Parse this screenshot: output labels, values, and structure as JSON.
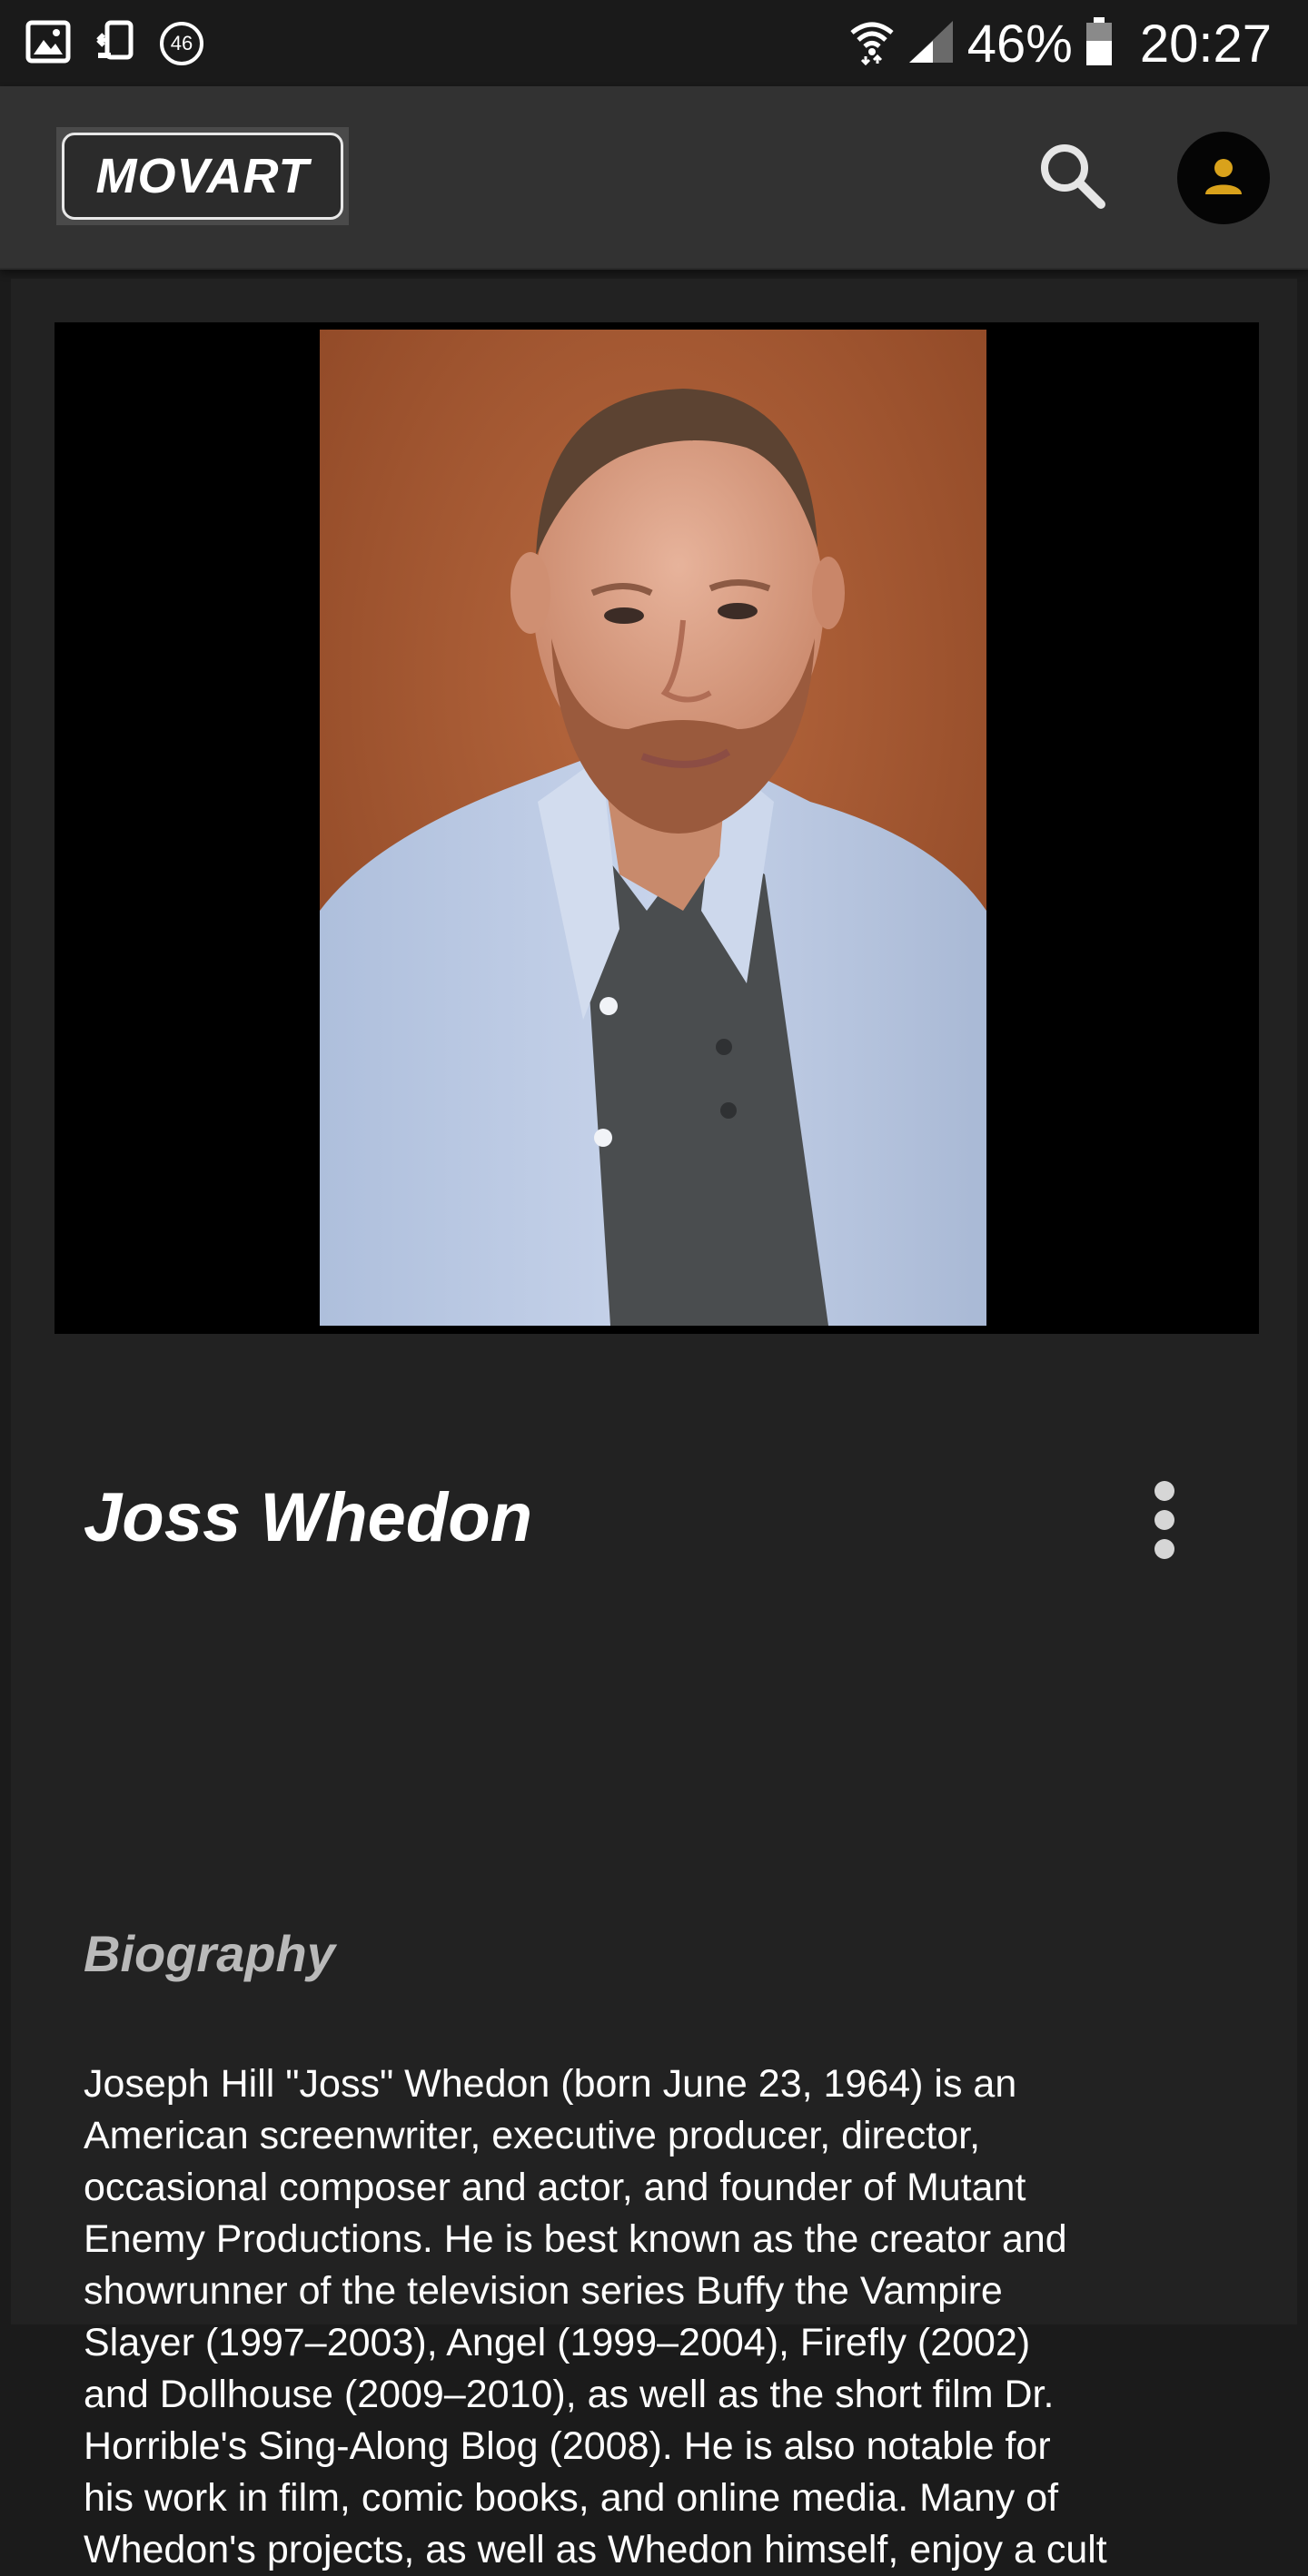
{
  "status_bar": {
    "left_icons": [
      "image-icon",
      "screen-cast-icon",
      "notification-count-icon"
    ],
    "notification_count": "46",
    "battery_percent": "46%",
    "time": "20:27",
    "right_icons": [
      "wifi-icon",
      "signal-icon",
      "battery-icon"
    ]
  },
  "app_bar": {
    "logo_text": "MOVART",
    "search_icon": "search-icon",
    "account_icon": "person-icon",
    "accent_color": "#d9a21b"
  },
  "person": {
    "name": "Joss Whedon",
    "photo_alt": "portrait",
    "menu_icon": "more-vert-icon"
  },
  "biography": {
    "heading": "Biography",
    "lines": [
      "Joseph Hill \"Joss\" Whedon (born June 23, 1964) is an",
      "American screenwriter, executive producer, director,",
      "occasional composer and actor, and founder of Mutant",
      "Enemy Productions. He is best known as the creator and",
      "showrunner of the television series Buffy the Vampire",
      "Slayer (1997–2003), Angel (1999–2004), Firefly (2002)",
      "and Dollhouse (2009–2010), as well as the short film Dr.",
      "Horrible's Sing-Along Blog (2008). He is also notable for",
      "his work in film, comic books, and online media. Many of",
      "Whedon's projects, as well as Whedon himself, enjoy a cult"
    ]
  }
}
